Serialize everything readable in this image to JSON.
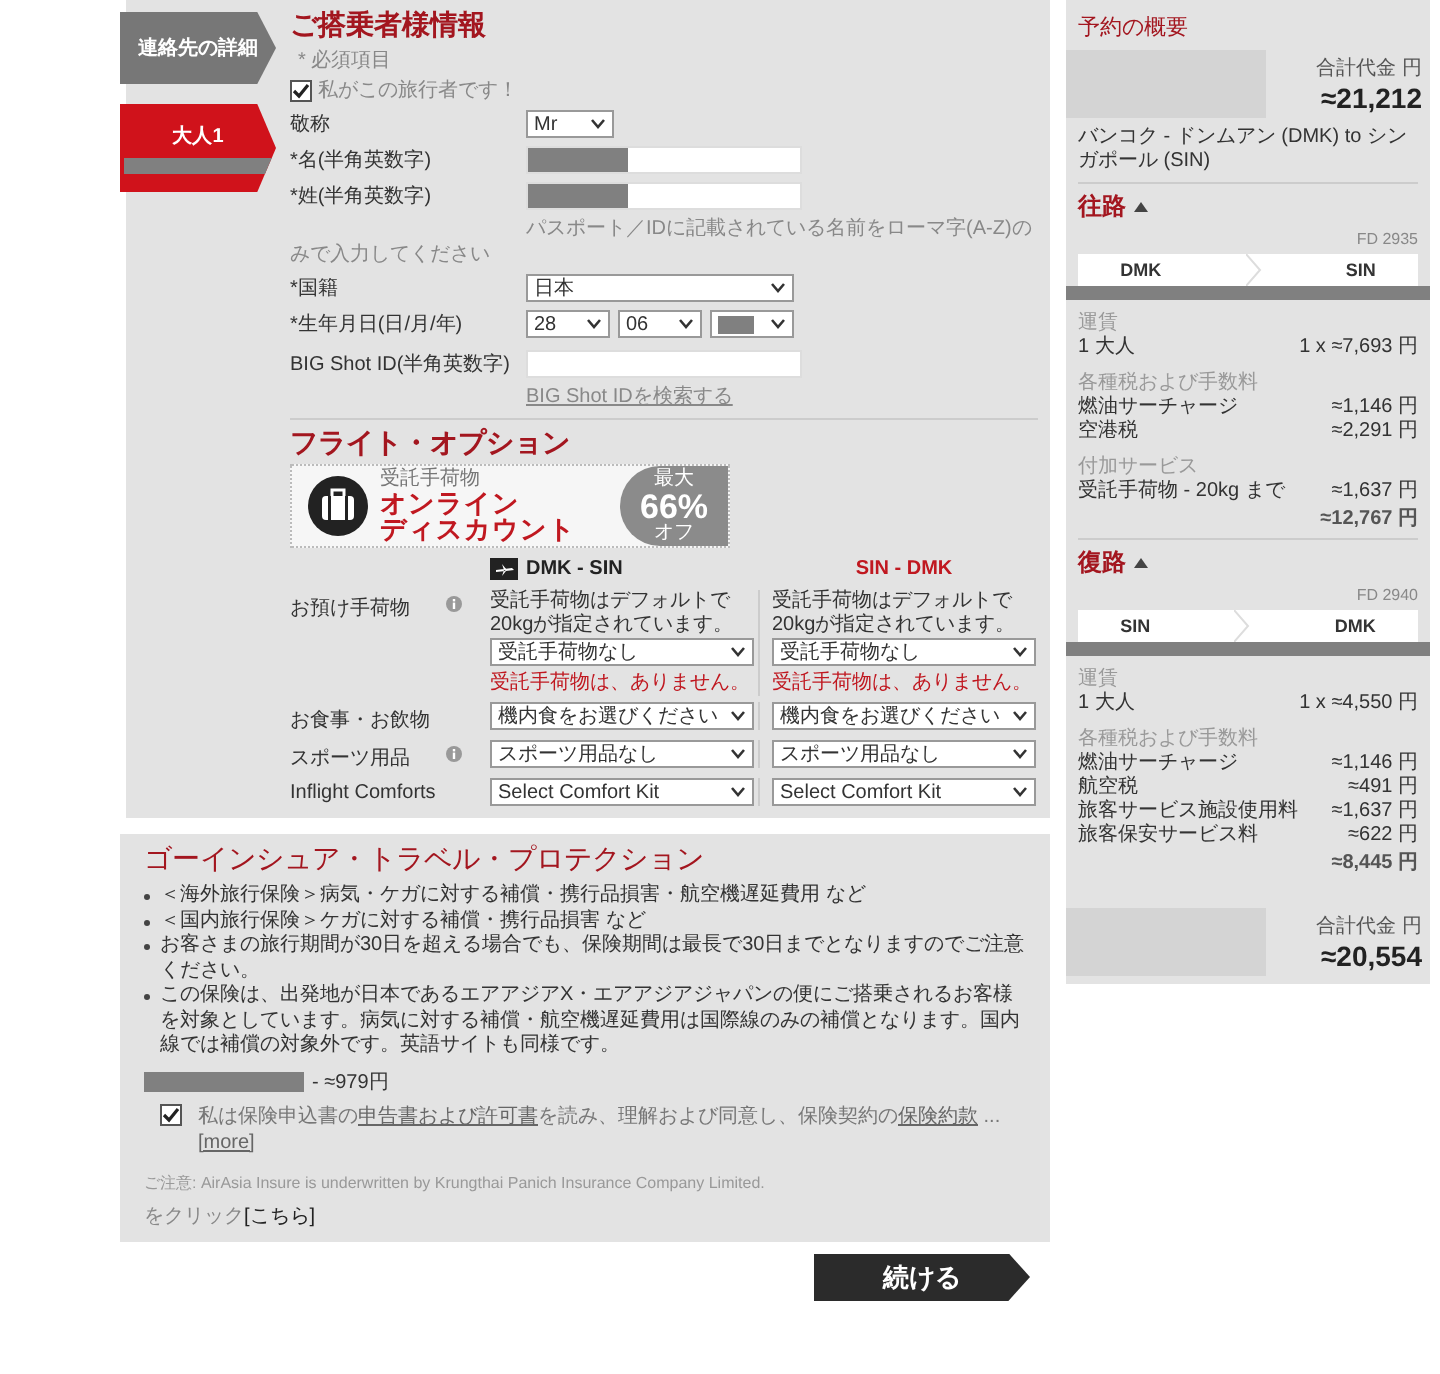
{
  "side_tabs": [
    {
      "label": "連絡先の詳細",
      "selected": false
    },
    {
      "label": "大人1",
      "selected": true,
      "redacted": true
    }
  ],
  "passenger": {
    "title": "ご搭乗者様情報",
    "required_note": "* 必須項目",
    "self_checkbox": {
      "label": "私がこの旅行者です！",
      "checked": true
    },
    "fields": [
      {
        "kind": "select",
        "label": "敬称",
        "value": "Mr",
        "wide": false
      },
      {
        "kind": "text",
        "label": "*名(半角英数字)",
        "redacted": true
      },
      {
        "kind": "text",
        "label": "*姓(半角英数字)",
        "redacted": true,
        "hint": "パスポート／IDに記載されている名前をローマ字(A-Z)のみで入力してください"
      },
      {
        "kind": "select",
        "label": "*国籍",
        "value": "日本",
        "wide": true
      },
      {
        "kind": "date",
        "label": "*生年月日(日/月/年)",
        "parts": [
          {
            "value": "28",
            "redacted": false
          },
          {
            "value": "06",
            "redacted": false
          },
          {
            "redacted": true
          }
        ]
      },
      {
        "kind": "text",
        "label": "BIG Shot ID(半角英数字)",
        "link": "BIG Shot IDを検索する"
      }
    ]
  },
  "flight_options": {
    "title": "フライト・オプション",
    "banner": {
      "caption": "受託手荷物",
      "headline_1": "オンライン",
      "headline_2": "ディスカウント",
      "badge_top": "最大",
      "badge_value": "66%",
      "badge_bottom": "オフ"
    },
    "legs": [
      {
        "label": "DMK - SIN",
        "selected": true
      },
      {
        "label": "SIN - DMK",
        "selected": false
      }
    ],
    "rows": [
      {
        "label": "お預け手荷物",
        "info": true,
        "cells": [
          {
            "note": "受託手荷物はデフォルトで20kgが指定されています。",
            "value": "受託手荷物なし",
            "warning": "受託手荷物は、ありません。"
          },
          {
            "note": "受託手荷物はデフォルトで20kgが指定されています。",
            "value": "受託手荷物なし",
            "warning": "受託手荷物は、ありません。"
          }
        ]
      },
      {
        "label": "お食事・お飲物",
        "info": false,
        "cells": [
          {
            "value": "機内食をお選びください"
          },
          {
            "value": "機内食をお選びください"
          }
        ]
      },
      {
        "label": "スポーツ用品",
        "info": true,
        "cells": [
          {
            "value": "スポーツ用品なし"
          },
          {
            "value": "スポーツ用品なし"
          }
        ]
      },
      {
        "label": "Inflight Comforts",
        "info": false,
        "cells": [
          {
            "value": "Select Comfort Kit"
          },
          {
            "value": "Select Comfort Kit"
          }
        ]
      }
    ]
  },
  "insurance": {
    "title": "ゴーインシュア・トラベル・プロテクション",
    "bullets": [
      "＜海外旅行保険＞病気・ケガに対する補償・携行品損害・航空機遅延費用 など",
      "＜国内旅行保険＞ケガに対する補償・携行品損害 など",
      "お客さまの旅行期間が30日を超える場合でも、保険期間は最長で30日までとなりますのでご注意ください。",
      "この保険は、出発地が日本であるエアアジアX・エアアジアジャパンの便にご搭乗されるお客様を対象としています。病気に対する補償・航空機遅延費用は国際線のみの補償となります。国内線では補償の対象外です。英語サイトも同様です。"
    ],
    "price": "- ≈979円",
    "price_redacted": true,
    "agree": {
      "checked": true,
      "segments": [
        {
          "kind": "text",
          "text": "私は保険申込書の"
        },
        {
          "kind": "link",
          "text": "申告書および許可書"
        },
        {
          "kind": "text",
          "text": "を読み、理解および同意し、保険契約の"
        },
        {
          "kind": "link",
          "text": "保険約款"
        },
        {
          "kind": "text",
          "text": " ... "
        },
        {
          "kind": "link",
          "text": "[more]"
        }
      ]
    },
    "note": "ご注意: AirAsia Insure is underwritten by Krungthai Panich Insurance Company Limited.",
    "click_text": "をクリック",
    "click_link": "[こちら]"
  },
  "continue_button": "続ける",
  "summary": {
    "title": "予約の概要",
    "total_top": {
      "label": "合計代金 円",
      "amount": "≈21,212"
    },
    "route": "バンコク - ドンムアン (DMK) to シンガポール (SIN)",
    "legs": [
      {
        "title": "往路",
        "expanded": true,
        "flight": "FD 2935",
        "from": "DMK",
        "to": "SIN",
        "groups": [
          {
            "heading": "運賃",
            "lines": [
              {
                "label": "1 大人",
                "amount": "1 x ≈7,693 円"
              }
            ]
          },
          {
            "heading": "各種税および手数料",
            "lines": [
              {
                "label": "燃油サーチャージ",
                "amount": "≈1,146 円"
              },
              {
                "label": "空港税",
                "amount": "≈2,291 円"
              }
            ]
          },
          {
            "heading": "付加サービス",
            "lines": [
              {
                "label": "受託手荷物 - 20kg まで",
                "amount": "≈1,637 円"
              }
            ]
          }
        ],
        "subtotal": "≈12,767 円"
      },
      {
        "title": "復路",
        "expanded": true,
        "flight": "FD 2940",
        "from": "SIN",
        "to": "DMK",
        "groups": [
          {
            "heading": "運賃",
            "lines": [
              {
                "label": "1 大人",
                "amount": "1 x ≈4,550 円"
              }
            ]
          },
          {
            "heading": "各種税および手数料",
            "lines": [
              {
                "label": "燃油サーチャージ",
                "amount": "≈1,146 円"
              },
              {
                "label": "航空税",
                "amount": "≈491 円"
              },
              {
                "label": "旅客サービス施設使用料",
                "amount": "≈1,637 円"
              },
              {
                "label": "旅客保安サービス料",
                "amount": "≈622 円"
              }
            ]
          }
        ],
        "subtotal": "≈8,445 円"
      }
    ],
    "total_bottom": {
      "label": "合計代金 円",
      "amount": "≈20,554"
    }
  }
}
